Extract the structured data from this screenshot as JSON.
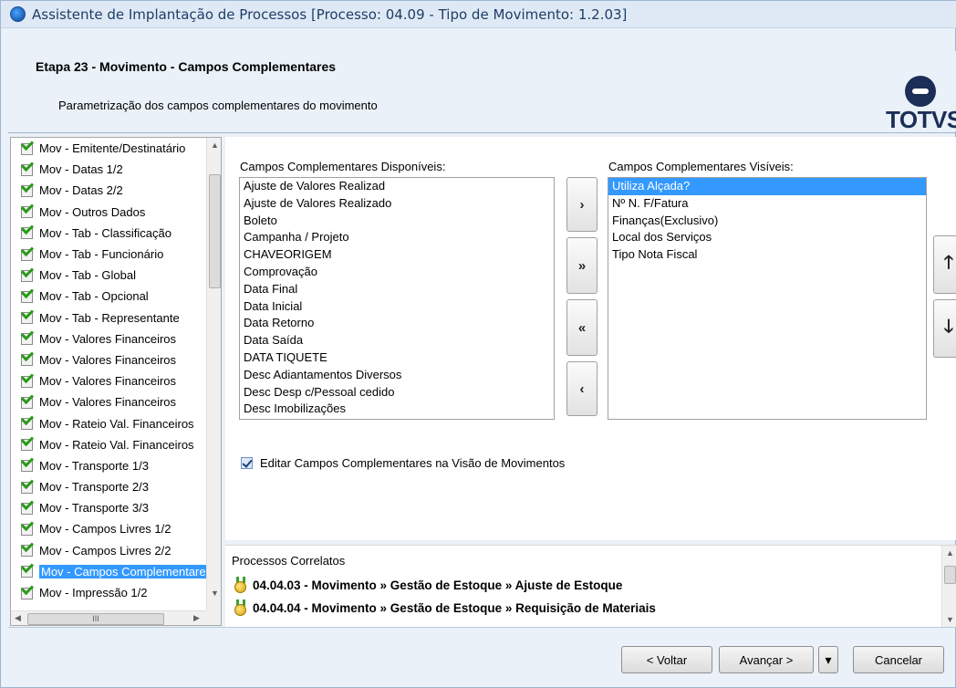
{
  "window": {
    "title": "Assistente de Implantação de Processos [Processo: 04.09 - Tipo de Movimento: 1.2.03]"
  },
  "header": {
    "step_title": "Etapa 23 - Movimento - Campos Complementares",
    "description": "Parametrização dos campos complementares do movimento",
    "logo_text": "TOTVS"
  },
  "tree": {
    "items": [
      {
        "label": "Mov - Emitente/Destinatário"
      },
      {
        "label": "Mov - Datas 1/2"
      },
      {
        "label": "Mov - Datas 2/2"
      },
      {
        "label": "Mov - Outros Dados"
      },
      {
        "label": "Mov - Tab - Classificação"
      },
      {
        "label": "Mov - Tab - Funcionário"
      },
      {
        "label": "Mov - Tab - Global"
      },
      {
        "label": "Mov - Tab - Opcional"
      },
      {
        "label": "Mov - Tab - Representante"
      },
      {
        "label": "Mov - Valores Financeiros"
      },
      {
        "label": "Mov - Valores Financeiros"
      },
      {
        "label": "Mov - Valores Financeiros"
      },
      {
        "label": "Mov - Valores Financeiros"
      },
      {
        "label": "Mov - Rateio Val. Financeiros"
      },
      {
        "label": "Mov - Rateio Val. Financeiros"
      },
      {
        "label": "Mov - Transporte 1/3"
      },
      {
        "label": "Mov - Transporte 2/3"
      },
      {
        "label": "Mov - Transporte 3/3"
      },
      {
        "label": "Mov - Campos Livres 1/2"
      },
      {
        "label": "Mov - Campos Livres 2/2"
      },
      {
        "label": "Mov - Campos Complementares"
      },
      {
        "label": "Mov - Impressão 1/2"
      }
    ],
    "selected_index": 20,
    "hscroll_grip": "III"
  },
  "available": {
    "label": "Campos Complementares Disponíveis:",
    "items": [
      "Ajuste de Valores Realizad",
      "Ajuste de Valores Realizado",
      "Boleto",
      "Campanha / Projeto",
      "CHAVEORIGEM",
      "Comprovação",
      "Data Final",
      "Data Inicial",
      "Data Retorno",
      "Data Saída",
      "DATA TIQUETE",
      "Desc Adiantamentos Diversos",
      "Desc Desp c/Pessoal cedido",
      "Desc Imobilizações"
    ]
  },
  "visible": {
    "label": "Campos Complementares Visíveis:",
    "items": [
      "Utiliza Alçada?",
      "Nº N. F/Fatura",
      "Finanças(Exclusivo)",
      "Local dos Serviços",
      "Tipo Nota Fiscal"
    ],
    "selected_index": 0
  },
  "transfer_buttons": {
    "add_one": "›",
    "add_all": "»",
    "remove_all": "«",
    "remove_one": "‹"
  },
  "order_buttons": {
    "up": "🡑",
    "down": "🡓"
  },
  "options": {
    "edit_in_view_label": "Editar Campos Complementares na Visão de Movimentos",
    "edit_in_view_checked": true
  },
  "related": {
    "title": "Processos Correlatos",
    "items": [
      "04.04.03 - Movimento » Gestão de Estoque » Ajuste de Estoque",
      "04.04.04 - Movimento » Gestão de Estoque » Requisição de Materiais"
    ]
  },
  "footer": {
    "back_label": "< Voltar",
    "next_label": "Avançar >",
    "next_menu_label": "▾",
    "cancel_label": "Cancelar"
  },
  "colors": {
    "selection": "#3399ff",
    "window_bg": "#eaf1f9",
    "brand": "#1a2e57",
    "check_green": "#2b9a1b"
  }
}
